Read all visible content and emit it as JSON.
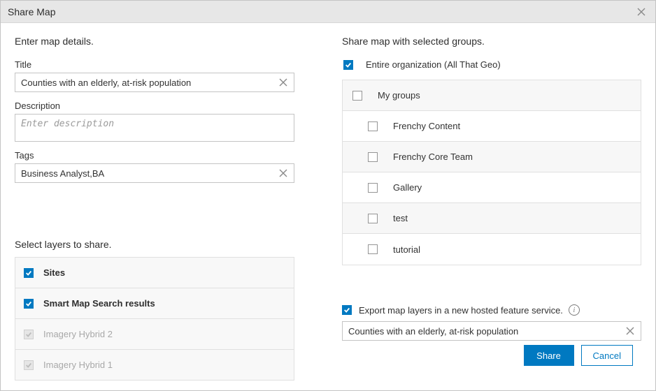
{
  "dialog": {
    "title": "Share Map"
  },
  "left": {
    "intro": "Enter map details.",
    "title_label": "Title",
    "title_value": "Counties with an elderly, at-risk population",
    "description_label": "Description",
    "description_placeholder": "Enter description",
    "description_value": "",
    "tags_label": "Tags",
    "tags_value": "Business Analyst,BA",
    "layers_label": "Select layers to share.",
    "layers": [
      {
        "label": "Sites",
        "checked": true,
        "enabled": true
      },
      {
        "label": "Smart Map Search results",
        "checked": true,
        "enabled": true
      },
      {
        "label": "Imagery Hybrid 2",
        "checked": true,
        "enabled": false
      },
      {
        "label": "Imagery Hybrid 1",
        "checked": true,
        "enabled": false
      }
    ]
  },
  "right": {
    "intro": "Share map with selected groups.",
    "org": {
      "label": "Entire organization (All That Geo)",
      "checked": true
    },
    "groups_header": "My groups",
    "groups": [
      {
        "label": "Frenchy Content",
        "checked": false
      },
      {
        "label": "Frenchy Core Team",
        "checked": false
      },
      {
        "label": "Gallery",
        "checked": false
      },
      {
        "label": "test",
        "checked": false
      },
      {
        "label": "tutorial",
        "checked": false
      }
    ],
    "export": {
      "label": "Export map layers in a new hosted feature service.",
      "checked": true,
      "name_value": "Counties with an elderly, at-risk population"
    }
  },
  "footer": {
    "share": "Share",
    "cancel": "Cancel"
  },
  "colors": {
    "accent": "#0079c1"
  }
}
